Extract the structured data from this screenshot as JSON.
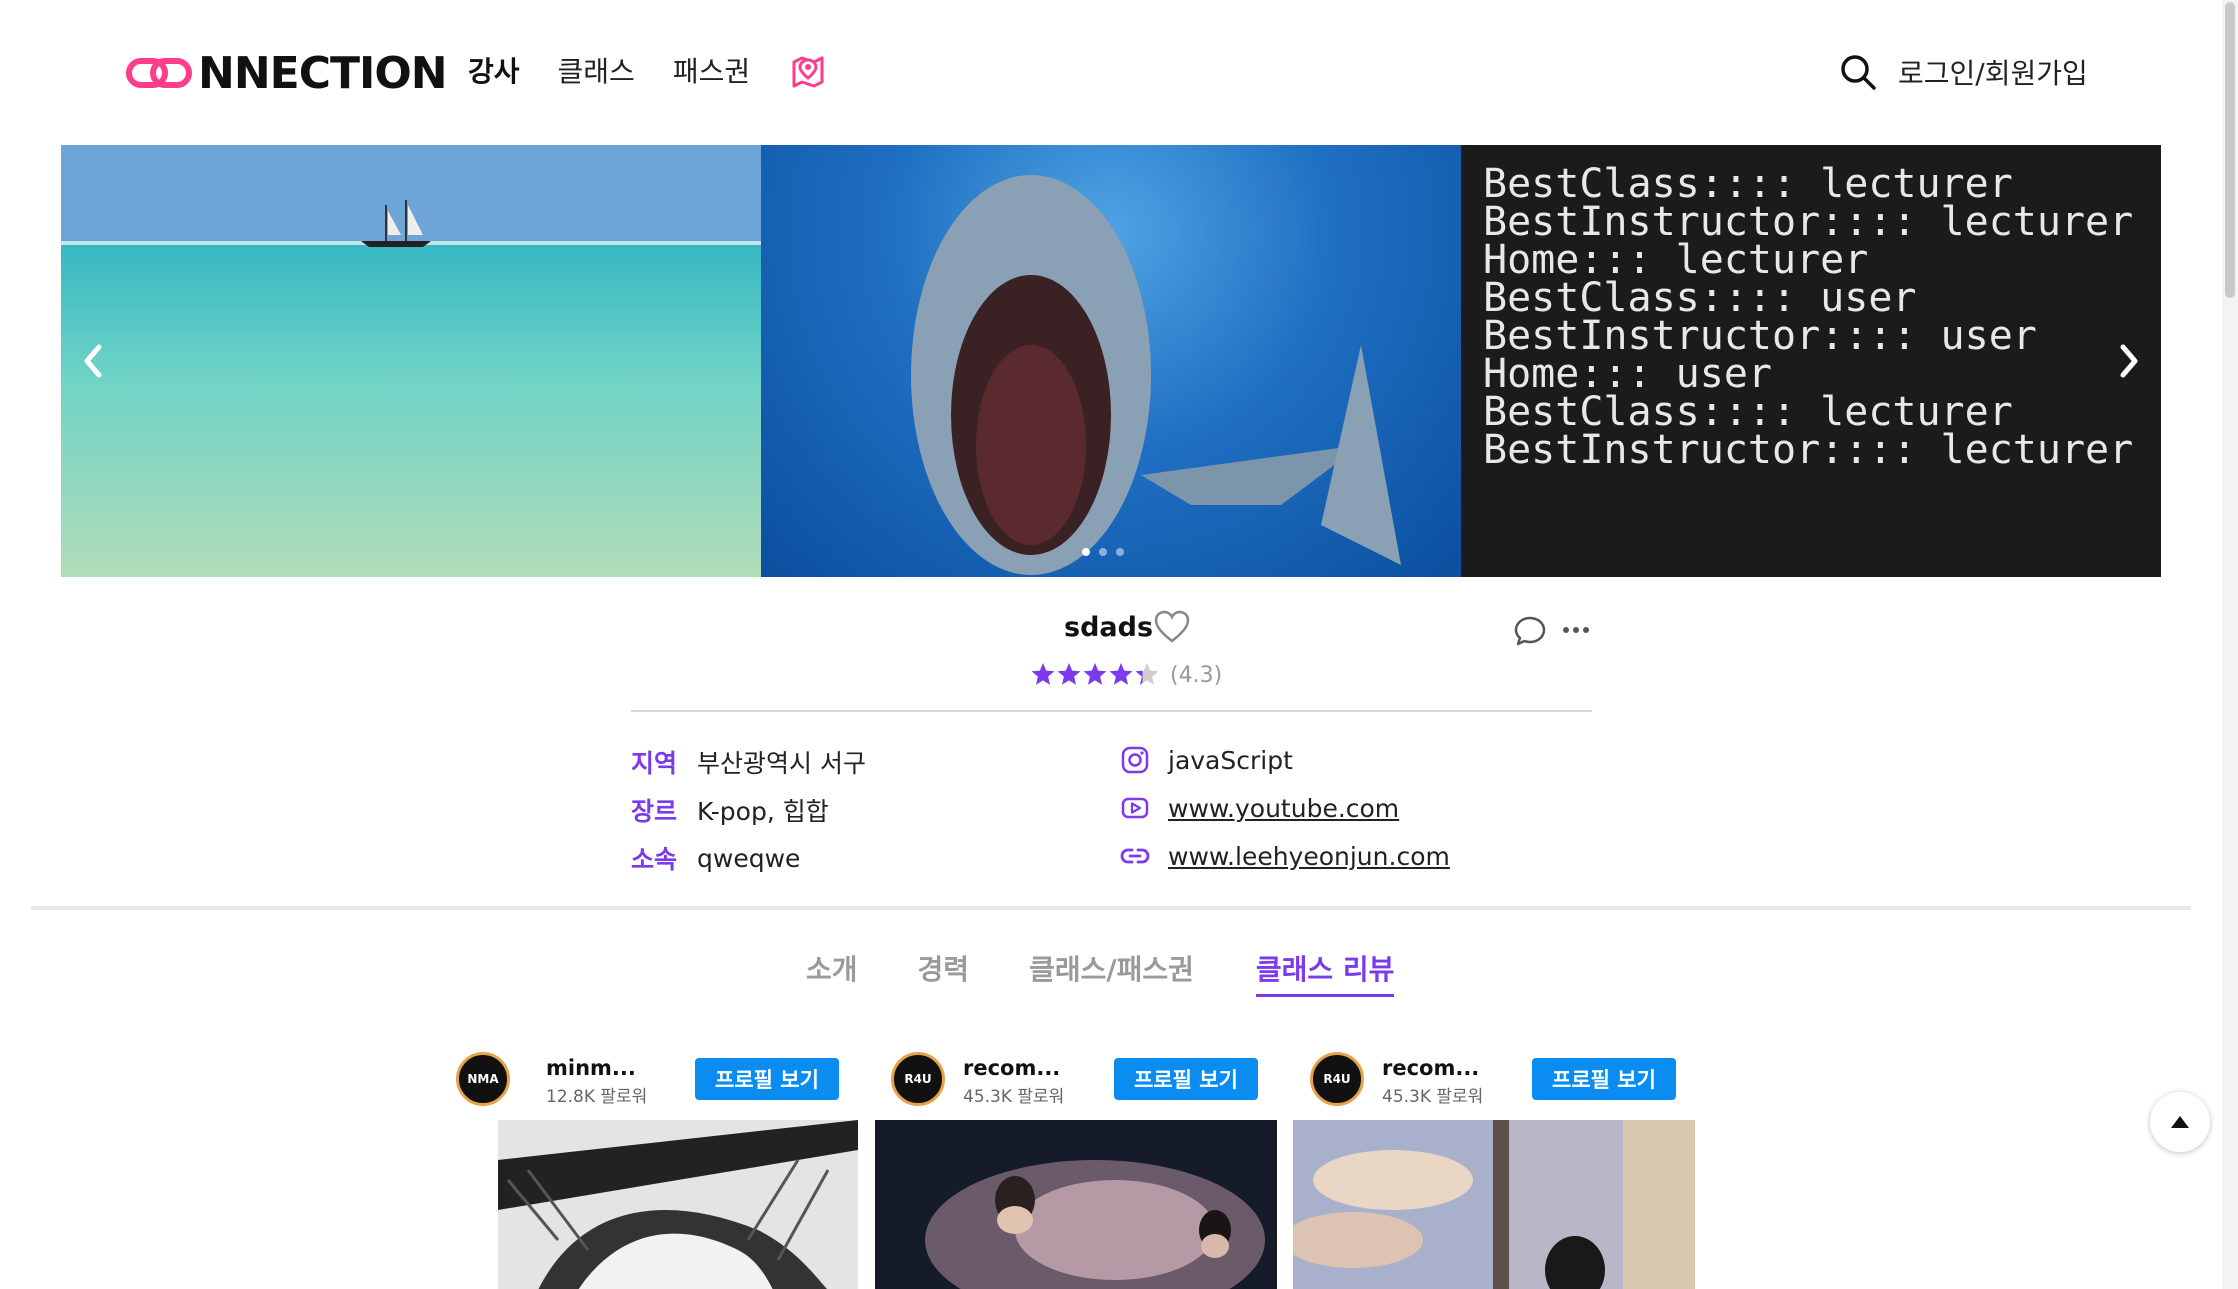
{
  "header": {
    "logo_text": "NNECTION",
    "nav": [
      {
        "label": "강사"
      },
      {
        "label": "클래스"
      },
      {
        "label": "패스권"
      }
    ],
    "login_label": "로그인/회원가입"
  },
  "carousel": {
    "code_lines": [
      "BestClass:::: lecturer",
      "BestInstructor:::: lecturer",
      "Home::: lecturer",
      "BestClass:::: user",
      "BestInstructor:::: user",
      "Home::: user",
      "BestClass:::: lecturer",
      "BestInstructor:::: lecturer"
    ],
    "active_dot": 0,
    "dot_count": 3
  },
  "profile": {
    "name": "sdads",
    "rating_value": 4.3,
    "rating_label": "(4.3)",
    "info": [
      {
        "key": "지역",
        "value": "부산광역시 서구"
      },
      {
        "key": "장르",
        "value": "K-pop, 힙합"
      },
      {
        "key": "소속",
        "value": "qweqwe"
      }
    ],
    "links": [
      {
        "icon": "instagram-icon",
        "text": "javaScript",
        "underline": false
      },
      {
        "icon": "youtube-icon",
        "text": "www.youtube.com",
        "underline": true
      },
      {
        "icon": "link-icon",
        "text": "www.leehyeonjun.com",
        "underline": true
      }
    ]
  },
  "tabs": [
    {
      "label": "소개",
      "active": false
    },
    {
      "label": "경력",
      "active": false
    },
    {
      "label": "클래스/패스권",
      "active": false
    },
    {
      "label": "클래스 리뷰",
      "active": true
    }
  ],
  "reviews": [
    {
      "name": "minm...",
      "followers": "12.8K 팔로워",
      "button": "프로필 보기",
      "avatar_text": "NMA"
    },
    {
      "name": "recom...",
      "followers": "45.3K 팔로워",
      "button": "프로필 보기",
      "avatar_text": "R4U"
    },
    {
      "name": "recom...",
      "followers": "45.3K 팔로워",
      "button": "프로필 보기",
      "avatar_text": "R4U"
    }
  ],
  "colors": {
    "accent": "#7c3aed",
    "logo_pink": "#ff3d8b",
    "button_blue": "#0a8cf0"
  }
}
